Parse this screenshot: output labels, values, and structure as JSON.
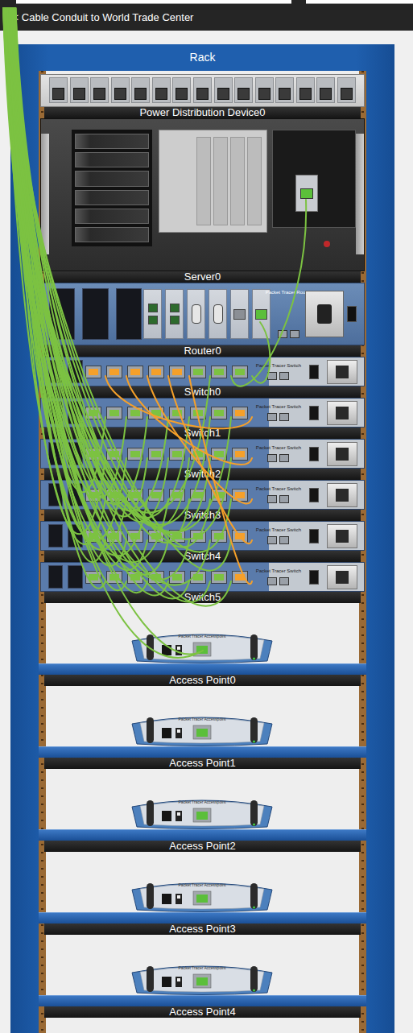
{
  "conduit": {
    "label": "<< Cable Conduit to World Trade Center"
  },
  "rack": {
    "title": "Rack"
  },
  "devices": [
    {
      "name": "Power Distribution Device0",
      "kind": "pdu"
    },
    {
      "name": "Server0",
      "kind": "server",
      "nic_linked": true
    },
    {
      "name": "Router0",
      "kind": "router",
      "brand": "Packet Tracer Router",
      "modules": [
        {
          "kind": "fiber",
          "linked": false
        },
        {
          "kind": "fiber",
          "linked": false
        },
        {
          "kind": "serial",
          "linked": false
        },
        {
          "kind": "serial",
          "linked": false
        },
        {
          "kind": "ethernet",
          "linked": false
        },
        {
          "kind": "ethernet",
          "linked": true
        }
      ]
    },
    {
      "name": "Switch0",
      "kind": "switch",
      "brand": "Packet Tracer Switch",
      "ports": [
        {
          "color": "#f5a02a"
        },
        {
          "color": "#f5a02a"
        },
        {
          "color": "#f5a02a"
        },
        {
          "color": "#f5a02a"
        },
        {
          "color": "#f5a02a"
        },
        {
          "color": "#7cc242"
        },
        {
          "color": "#7cc242"
        },
        {
          "color": "#7cc242"
        }
      ]
    },
    {
      "name": "Switch1",
      "kind": "switch",
      "brand": "Packet Tracer Switch",
      "ports": [
        {
          "color": "#7cc242"
        },
        {
          "color": "#7cc242"
        },
        {
          "color": "#7cc242"
        },
        {
          "color": "#7cc242"
        },
        {
          "color": "#7cc242"
        },
        {
          "color": "#7cc242"
        },
        {
          "color": "#7cc242"
        },
        {
          "color": "#f5a02a"
        }
      ]
    },
    {
      "name": "Switch2",
      "kind": "switch",
      "brand": "Packet Tracer Switch",
      "ports": [
        {
          "color": "#7cc242"
        },
        {
          "color": "#7cc242"
        },
        {
          "color": "#7cc242"
        },
        {
          "color": "#7cc242"
        },
        {
          "color": "#7cc242"
        },
        {
          "color": "#7cc242"
        },
        {
          "color": "#7cc242"
        },
        {
          "color": "#f5a02a"
        }
      ]
    },
    {
      "name": "Switch3",
      "kind": "switch",
      "brand": "Packet Tracer Switch",
      "ports": [
        {
          "color": "#7cc242"
        },
        {
          "color": "#7cc242"
        },
        {
          "color": "#7cc242"
        },
        {
          "color": "#7cc242"
        },
        {
          "color": "#7cc242"
        },
        {
          "color": "#7cc242"
        },
        {
          "color": "#7cc242"
        },
        {
          "color": "#f5a02a"
        }
      ]
    },
    {
      "name": "Switch4",
      "kind": "switch",
      "brand": "Packet Tracer Switch",
      "ports": [
        {
          "color": "#7cc242"
        },
        {
          "color": "#7cc242"
        },
        {
          "color": "#7cc242"
        },
        {
          "color": "#7cc242"
        },
        {
          "color": "#7cc242"
        },
        {
          "color": "#7cc242"
        },
        {
          "color": "#7cc242"
        },
        {
          "color": "#f5a02a"
        }
      ]
    },
    {
      "name": "Switch5",
      "kind": "switch",
      "brand": "Packet Tracer Switch",
      "ports": [
        {
          "color": "#7cc242"
        },
        {
          "color": "#7cc242"
        },
        {
          "color": "#7cc242"
        },
        {
          "color": "#7cc242"
        },
        {
          "color": "#7cc242"
        },
        {
          "color": "#7cc242"
        },
        {
          "color": "#7cc242"
        },
        {
          "color": "#f5a02a"
        }
      ]
    },
    {
      "name": "Access Point0",
      "kind": "access-point",
      "brand": "Packet Tracer Accesspoint"
    },
    {
      "name": "Access Point1",
      "kind": "access-point",
      "brand": "Packet Tracer Accesspoint"
    },
    {
      "name": "Access Point2",
      "kind": "access-point",
      "brand": "Packet Tracer Accesspoint"
    },
    {
      "name": "Access Point3",
      "kind": "access-point",
      "brand": "Packet Tracer Accesspoint"
    },
    {
      "name": "Access Point4",
      "kind": "access-point",
      "brand": "Packet Tracer Accesspoint"
    }
  ]
}
